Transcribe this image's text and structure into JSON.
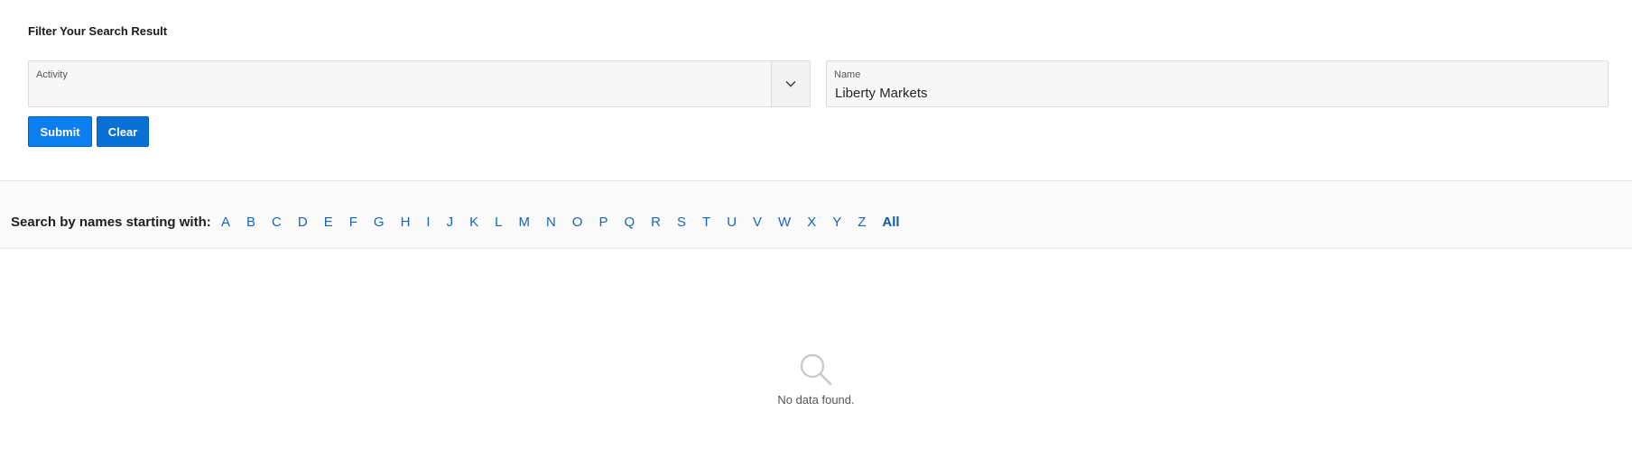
{
  "filter": {
    "heading": "Filter Your Search Result",
    "activity": {
      "label": "Activity",
      "value": ""
    },
    "name": {
      "label": "Name",
      "value": "Liberty Markets"
    },
    "submit_label": "Submit",
    "clear_label": "Clear"
  },
  "alphabet": {
    "label": "Search by names starting with:",
    "letters": [
      "A",
      "B",
      "C",
      "D",
      "E",
      "F",
      "G",
      "H",
      "I",
      "J",
      "K",
      "L",
      "M",
      "N",
      "O",
      "P",
      "Q",
      "R",
      "S",
      "T",
      "U",
      "V",
      "W",
      "X",
      "Y",
      "Z",
      "All"
    ],
    "active": "All"
  },
  "results": {
    "empty_message": "No data found.",
    "empty_icon": "search-icon"
  },
  "colors": {
    "accent": "#0b7ff0",
    "link": "#1565c0"
  }
}
